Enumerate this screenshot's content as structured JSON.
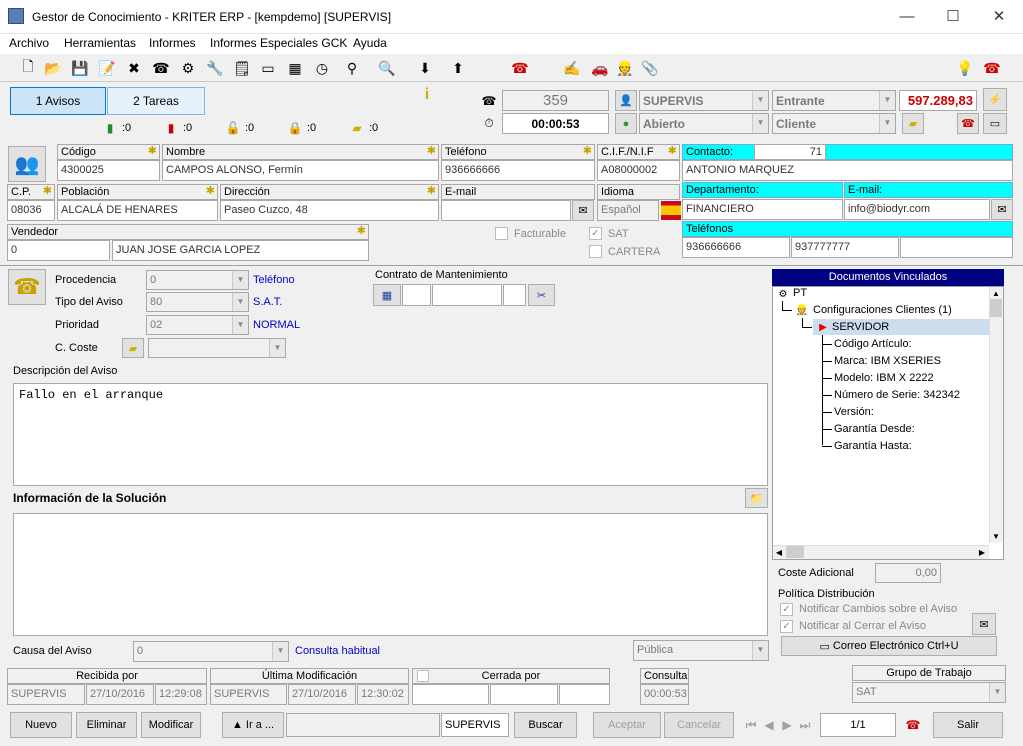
{
  "window": {
    "title": "Gestor de Conocimiento - KRITER ERP - [kempdemo] [SUPERVIS]",
    "min": "—",
    "max": "☐",
    "close": "✕"
  },
  "menu": [
    "Archivo",
    "Herramientas",
    "Informes",
    "Informes Especiales GCK",
    "Ayuda"
  ],
  "tabs": {
    "avisos": "1 Avisos",
    "tareas": "2 Tareas"
  },
  "counters": [
    ":0",
    ":0",
    ":0",
    ":0",
    ":0"
  ],
  "status": {
    "number": "359",
    "timer": "00:00:53",
    "user": "SUPERVIS",
    "direction": "Entrante",
    "amount": "597.289,83",
    "state": "Abierto",
    "type": "Cliente"
  },
  "client": {
    "codigo_label": "Código",
    "codigo": "4300025",
    "nombre_label": "Nombre",
    "nombre": "CAMPOS ALONSO, Fermín",
    "telefono_label": "Teléfono",
    "telefono": "936666666",
    "cif_label": "C.I.F./N.I.F",
    "cif": "A08000002",
    "cp_label": "C.P.",
    "cp": "08036",
    "poblacion_label": "Población",
    "poblacion": "ALCALÁ DE HENARES",
    "direccion_label": "Dirección",
    "direccion": "Paseo Cuzco, 48",
    "email_label": "E-mail",
    "email": "",
    "idioma_label": "Idioma",
    "idioma": "Español",
    "vendedor_label": "Vendedor",
    "vendedor_code": "0",
    "vendedor": "JUAN JOSE GARCIA LOPEZ",
    "facturable": "Facturable",
    "sat": "SAT",
    "cartera": "CARTERA"
  },
  "contact": {
    "contacto_label": "Contacto:",
    "contacto_num": "71",
    "contacto": "ANTONIO MARQUEZ",
    "departamento_label": "Departamento:",
    "departamento": "FINANCIERO",
    "email_label": "E-mail:",
    "email": "info@biodyr.com",
    "telefonos_label": "Teléfonos",
    "tel1": "936666666",
    "tel2": "937777777"
  },
  "aviso": {
    "procedencia_label": "Procedencia",
    "procedencia": "0",
    "procedencia_txt": "Teléfono",
    "tipo_label": "Tipo del Aviso",
    "tipo": "80",
    "tipo_txt": "S.A.T.",
    "prioridad_label": "Prioridad",
    "prioridad": "02",
    "prioridad_txt": "NORMAL",
    "coste_label": "C. Coste",
    "contrato_label": "Contrato de Mantenimiento",
    "descripcion_label": "Descripción del Aviso",
    "descripcion": "Fallo en el arranque",
    "solucion_label": "Información de la Solución",
    "causa_label": "Causa del Aviso",
    "causa": "0",
    "causa_txt": "Consulta habitual",
    "visibilidad": "Pública"
  },
  "docs": {
    "title": "Documentos Vinculados",
    "root": "PT",
    "node": "Configuraciones Clientes (1)",
    "item": "SERVIDOR",
    "leaves": [
      "Código Artículo:",
      "Marca: IBM XSERIES",
      "Modelo: IBM X 2222",
      "Número de Serie: 342342",
      "Versión:",
      "Garantía Desde:",
      "Garantía Hasta:"
    ],
    "coste_label": "Coste Adicional",
    "coste": "0,00",
    "politica_label": "Política Distribución",
    "notif1": "Notificar Cambios sobre el Aviso",
    "notif2": "Notificar al Cerrar el Aviso",
    "correo": "Correo Electrónico Ctrl+U"
  },
  "footer": {
    "recibida_label": "Recibida por",
    "recibida_user": "SUPERVIS",
    "recibida_date": "27/10/2016",
    "recibida_time": "12:29:08",
    "modif_label": "Última Modificación",
    "modif_user": "SUPERVIS",
    "modif_date": "27/10/2016",
    "modif_time": "12:30:02",
    "cerrada_label": "Cerrada por",
    "consulta_label": "Consulta",
    "consulta": "00:00:53",
    "grupo_label": "Grupo de Trabajo",
    "grupo": "SAT"
  },
  "actions": {
    "nuevo": "Nuevo",
    "eliminar": "Eliminar",
    "modificar": "Modificar",
    "ira": "▲ Ir a ...",
    "user": "SUPERVIS",
    "buscar": "Buscar",
    "aceptar": "Aceptar",
    "cancelar": "Cancelar",
    "page": "1/1",
    "salir": "Salir"
  }
}
